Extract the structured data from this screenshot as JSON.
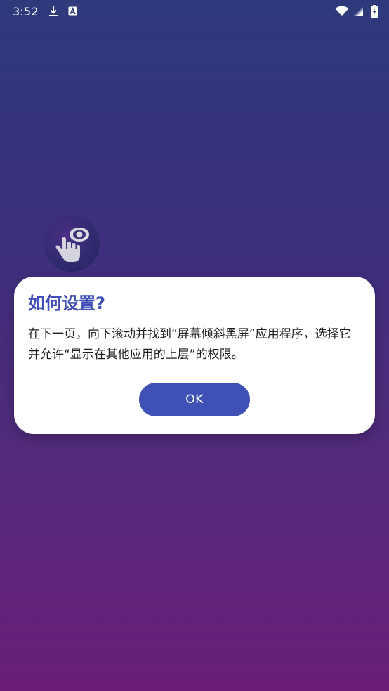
{
  "status_bar": {
    "time": "3:52",
    "icons": [
      "download-icon",
      "font-a-icon",
      "wifi-icon",
      "signal-icon",
      "battery-icon"
    ]
  },
  "app_icon": {
    "name": "eye-hand-app-icon"
  },
  "dialog": {
    "title": "如何设置?",
    "message": "在下一页，向下滚动并找到“屏幕倾斜黑屏”应用程序，选择它并允许“显示在其他应用的上层”的权限。",
    "ok_label": "OK"
  },
  "colors": {
    "background_top": "#2e3a7c",
    "background_bottom": "#6a1e78",
    "accent": "#3f51b5",
    "title": "#3f4fb5",
    "dialog_bg": "#ffffff"
  }
}
